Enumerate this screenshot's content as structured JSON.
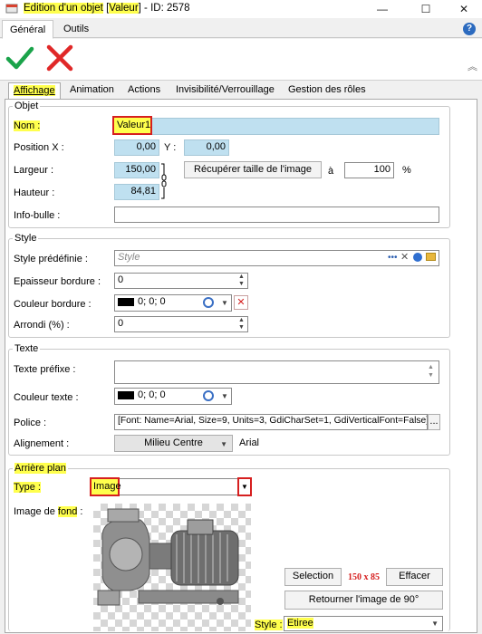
{
  "window": {
    "title_parts": [
      "Edition d'un ",
      "objet",
      " [",
      "Valeur",
      "] - ID: 2578"
    ],
    "min_label": "—",
    "max_label": "☐",
    "close_label": "✕"
  },
  "ribbon": {
    "tabs": [
      "Général",
      "Outils"
    ],
    "help_label": "?",
    "collapse_label": "︽"
  },
  "toolbar": {
    "ok_icon": "check-icon",
    "cancel_icon": "cross-icon",
    "ok_color": "#1aa34a",
    "cancel_color": "#e02828"
  },
  "tabs": [
    "Affichage",
    "Animation",
    "Actions",
    "Invisibilité/Verrouillage",
    "Gestion des rôles"
  ],
  "objet": {
    "title": "Objet",
    "nom_label": "Nom :",
    "nom_value": "Valeur1",
    "posx_label": "Position X :",
    "posx_value": "0,00",
    "y_label": "Y :",
    "y_value": "0,00",
    "largeur_label": "Largeur :",
    "largeur_value": "150,00",
    "hauteur_label": "Hauteur :",
    "hauteur_value": "84,81",
    "recuperer_label": "Récupérer taille de l'image",
    "a_label": "à",
    "pct_value": "100",
    "pct_label": "%",
    "infobulle_label": "Info-bulle :",
    "infobulle_value": ""
  },
  "style": {
    "title": "Style",
    "predefini_label": "Style prédéfinie :",
    "predefini_placeholder": "Style",
    "epaisseur_label": "Epaisseur bordure :",
    "epaisseur_value": "0",
    "couleur_label": "Couleur bordure :",
    "couleur_value": "0; 0; 0",
    "arrondi_label": "Arrondi (%) :",
    "arrondi_value": "0"
  },
  "texte": {
    "title": "Texte",
    "prefixe_label": "Texte préfixe :",
    "prefixe_value": "",
    "couleur_label": "Couleur texte :",
    "couleur_value": "0; 0; 0",
    "police_label": "Police :",
    "police_value": "[Font: Name=Arial, Size=9, Units=3, GdiCharSet=1, GdiVerticalFont=False]",
    "police_btn": "...",
    "alignement_label": "Alignement :",
    "alignement_value": "Milieu Centre",
    "font_name": "Arial"
  },
  "arriere": {
    "title": "Arrière plan",
    "type_label": "Type :",
    "type_value": "Image",
    "image_label_parts": [
      "Image de ",
      "fond",
      " :"
    ],
    "selection_label": "Selection",
    "size_text": "150 x 85",
    "effacer_label": "Effacer",
    "retourner_label": "Retourner l'image de 90°",
    "style_label": "Style :",
    "style_value": "Etiree"
  }
}
